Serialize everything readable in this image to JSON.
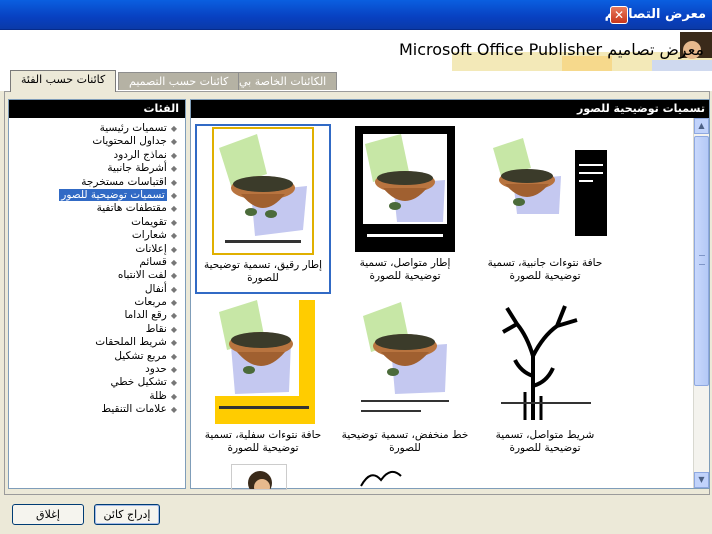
{
  "window": {
    "title": "معرض التصاميم",
    "header_title": "معرض تصاميم Microsoft Office Publisher"
  },
  "tabs": [
    {
      "label": "كائنات حسب الفئة",
      "active": true
    },
    {
      "label": "كائنات حسب التصميم",
      "active": false
    },
    {
      "label": "الكائنات الخاصة بي",
      "active": false
    }
  ],
  "categories": {
    "header": "الفئات",
    "items": [
      "تسميات رئيسية",
      "جداول المحتويات",
      "نماذج الردود",
      "أشرطة جانبية",
      "اقتباسات مستخرجة",
      "تسميات توضيحية للصور",
      "مقتطفات هاتفية",
      "تقويمات",
      "شعارات",
      "إعلانات",
      "قسائم",
      "لفت الانتباه",
      "أنفال",
      "مربعات",
      "رقع الداما",
      "نقاط",
      "شريط الملحقات",
      "مربع تشكيل",
      "حدود",
      "تشكيل خطي",
      "ظلة",
      "علامات التنقيط"
    ],
    "selected_index": 5
  },
  "gallery": {
    "header": "تسميات توضيحية للصور",
    "items": [
      {
        "label": "إطار رقيق، تسمية توضيحية للصورة",
        "selected": true
      },
      {
        "label": "إطار متواصل، تسمية توضيحية للصورة",
        "selected": false
      },
      {
        "label": "حافة نتوءات جانبية، تسمية توضيحية للصورة",
        "selected": false
      },
      {
        "label": "حافة نتوءات سفلية، تسمية توضيحية للصورة",
        "selected": false
      },
      {
        "label": "خط منخفض، تسمية توضيحية للصورة",
        "selected": false
      },
      {
        "label": "شريط متواصل، تسمية توضيحية للصورة",
        "selected": false
      }
    ]
  },
  "buttons": {
    "insert": "إدراج كائن",
    "close": "إغلاق"
  },
  "colors": {
    "title_bar": "#0a5fe0",
    "selection": "#316ac5",
    "yellow_accent": "#ffcc00"
  }
}
